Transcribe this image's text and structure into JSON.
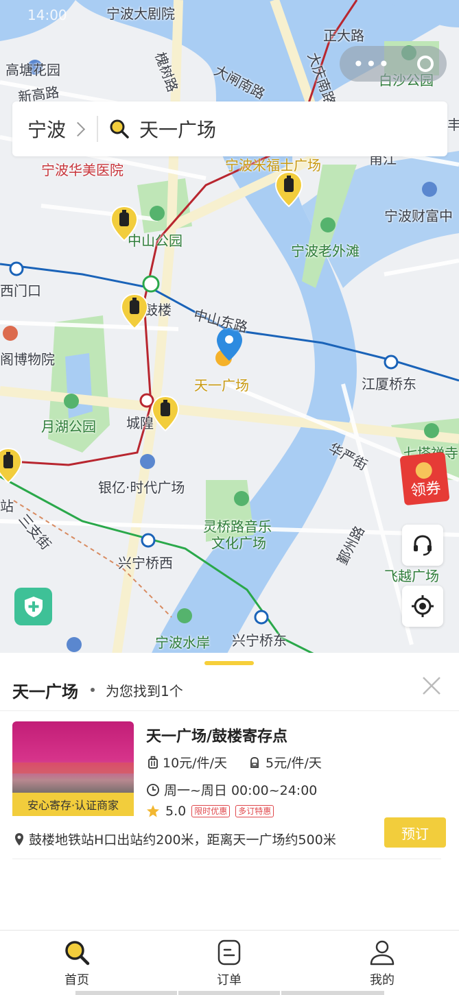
{
  "status_bar": {
    "time": "14:00"
  },
  "search": {
    "city": "宁波",
    "query": "天一广场"
  },
  "map": {
    "labels": [
      {
        "text": "宁波大剧院",
        "tone": "dark"
      },
      {
        "text": "正大路",
        "tone": "dark"
      },
      {
        "text": "高塘花园",
        "tone": "dark"
      },
      {
        "text": "大闸南路",
        "tone": "dark"
      },
      {
        "text": "白沙公园",
        "tone": "green"
      },
      {
        "text": "新高路",
        "tone": "dark"
      },
      {
        "text": "宁波华美医院",
        "tone": "red"
      },
      {
        "text": "宁波米福士广场",
        "tone": "orange"
      },
      {
        "text": "甬江",
        "tone": "dark"
      },
      {
        "text": "宁波财富中",
        "tone": "dark"
      },
      {
        "text": "中山公园",
        "tone": "green"
      },
      {
        "text": "宁波老外滩",
        "tone": "green"
      },
      {
        "text": "西门口",
        "tone": "dark"
      },
      {
        "text": "鼓楼",
        "tone": "dark"
      },
      {
        "text": "中山东路",
        "tone": "dark"
      },
      {
        "text": "阁博物院",
        "tone": "dark"
      },
      {
        "text": "天一广场",
        "tone": "orange"
      },
      {
        "text": "江厦桥东",
        "tone": "dark"
      },
      {
        "text": "月湖公园",
        "tone": "green"
      },
      {
        "text": "城隍",
        "tone": "dark"
      },
      {
        "text": "华严街",
        "tone": "dark"
      },
      {
        "text": "七塔禅寺",
        "tone": "green"
      },
      {
        "text": "银亿·时代广场",
        "tone": "dark"
      },
      {
        "text": "灵桥路音乐",
        "tone": "green"
      },
      {
        "text": "文化广场",
        "tone": "green"
      },
      {
        "text": "兴宁桥西",
        "tone": "dark"
      },
      {
        "text": "飞越广场",
        "tone": "green"
      },
      {
        "text": "宁波水岸",
        "tone": "green"
      },
      {
        "text": "兴宁桥东",
        "tone": "dark"
      },
      {
        "text": "站",
        "tone": "dark"
      },
      {
        "text": "三支街",
        "tone": "dark"
      },
      {
        "text": "槐树路",
        "tone": "dark"
      },
      {
        "text": "大庆南路",
        "tone": "dark"
      },
      {
        "text": "丰",
        "tone": "dark"
      },
      {
        "text": "鄞州路",
        "tone": "dark"
      }
    ],
    "coupon_label": "领券"
  },
  "result": {
    "title": "天一广场",
    "found_text": "为您找到1个",
    "store": {
      "name": "天一广场/鼓楼寄存点",
      "badge": "安心寄存·认证商家",
      "price_large": "10元/件/天",
      "price_small": "5元/件/天",
      "hours": "周一~周日 00:00~24:00",
      "rating": "5.0",
      "tags": [
        "限时优惠",
        "多订特惠"
      ],
      "address": "鼓楼地铁站H口出站约200米，距离天一广场约500米",
      "book_label": "预订"
    }
  },
  "tabs": [
    {
      "label": "首页",
      "icon": "search-icon",
      "active": true
    },
    {
      "label": "订单",
      "icon": "order-icon",
      "active": false
    },
    {
      "label": "我的",
      "icon": "user-icon",
      "active": false
    }
  ],
  "colors": {
    "accent": "#f2cd3c",
    "metro_blue": "#1a63b8",
    "metro_red": "#b8262f",
    "metro_green": "#2aa84a",
    "river": "#a9cdf3",
    "park": "#bfe6b7"
  }
}
